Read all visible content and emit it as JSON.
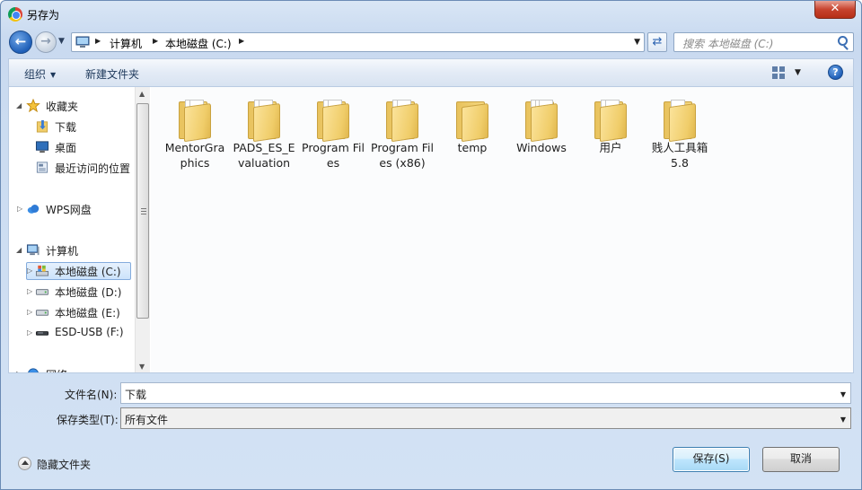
{
  "window": {
    "title": "另存为",
    "close_label": "✕"
  },
  "nav": {
    "back_glyph": "←",
    "forward_glyph": "→",
    "breadcrumbs": [
      "计算机",
      "本地磁盘 (C:)"
    ],
    "search_placeholder": "搜索 本地磁盘 (C:)"
  },
  "toolbar": {
    "organize_label": "组织",
    "new_folder_label": "新建文件夹",
    "help_glyph": "?"
  },
  "sidebar": {
    "items": [
      {
        "label": "收藏夹",
        "icon": "star-icon"
      },
      {
        "label": "下载",
        "icon": "download-folder-icon"
      },
      {
        "label": "桌面",
        "icon": "desktop-icon"
      },
      {
        "label": "最近访问的位置",
        "icon": "recent-places-icon"
      },
      {
        "label": "WPS网盘",
        "icon": "cloud-icon"
      },
      {
        "label": "计算机",
        "icon": "computer-icon"
      },
      {
        "label": "本地磁盘 (C:)",
        "icon": "system-drive-icon",
        "selected": true
      },
      {
        "label": "本地磁盘 (D:)",
        "icon": "drive-icon"
      },
      {
        "label": "本地磁盘 (E:)",
        "icon": "drive-icon"
      },
      {
        "label": "ESD-USB (F:)",
        "icon": "usb-drive-icon"
      },
      {
        "label": "网络",
        "icon": "network-icon"
      }
    ]
  },
  "files": [
    {
      "name": "MentorGraphics",
      "icon": "folder-icon"
    },
    {
      "name": "PADS_ES_Evaluation",
      "icon": "folder-icon"
    },
    {
      "name": "Program Files",
      "icon": "folder-icon"
    },
    {
      "name": "Program Files (x86)",
      "icon": "folder-icon"
    },
    {
      "name": "temp",
      "icon": "empty-folder-icon"
    },
    {
      "name": "Windows",
      "icon": "folder-icon"
    },
    {
      "name": "用户",
      "icon": "folder-icon"
    },
    {
      "name": "贱人工具箱5.8",
      "icon": "folder-icon"
    }
  ],
  "form": {
    "filename_label": "文件名(N):",
    "filename_value": "下载",
    "filetype_label": "保存类型(T):",
    "filetype_value": "所有文件"
  },
  "footer": {
    "hide_folders_label": "隐藏文件夹",
    "save_label": "保存(S)",
    "cancel_label": "取消"
  }
}
